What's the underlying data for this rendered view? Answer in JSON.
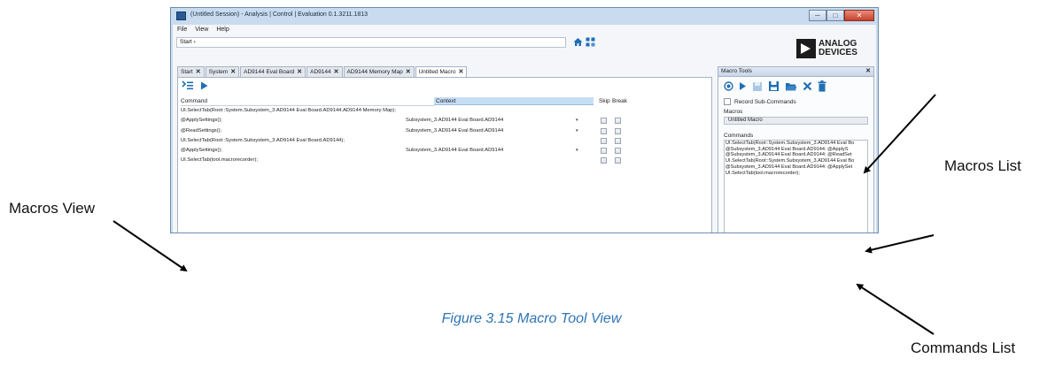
{
  "window": {
    "title": "(Untitled Session) - Analysis | Control | Evaluation 0.1.3211.1813",
    "caption_min": "─",
    "caption_max": "□",
    "caption_close": "✕"
  },
  "menu": [
    "File",
    "View",
    "Help"
  ],
  "breadcrumb": "Start  ›",
  "logo": {
    "line1": "ANALOG",
    "line2": "DEVICES"
  },
  "tabs": [
    {
      "label": "Start",
      "active": false
    },
    {
      "label": "System",
      "active": false
    },
    {
      "label": "AD9144 Eval Board",
      "active": false
    },
    {
      "label": "AD9144",
      "active": false
    },
    {
      "label": "AD9144 Memory Map",
      "active": false
    },
    {
      "label": "Untitled Macro",
      "active": true
    }
  ],
  "tab_close": "✕",
  "grid": {
    "columns": {
      "command": "Command",
      "context": "Context",
      "skip": "Skip",
      "break": "Break"
    },
    "rows": [
      {
        "command": "UI.SelectTab(Root::System.Subsystem_3.AD9144 Eval Board.AD9144.AD9144 Memory Map);",
        "context": "",
        "checks": false
      },
      {
        "command": "@ApplySettings();",
        "context": "Subsystem_3.AD9144 Eval Board.AD9144",
        "checks": true
      },
      {
        "command": "@ReadSettings();",
        "context": "Subsystem_3.AD9144 Eval Board.AD9144",
        "checks": true
      },
      {
        "command": "UI.SelectTab(Root::System.Subsystem_3.AD9144 Eval Board.AD9144);",
        "context": "",
        "checks": true
      },
      {
        "command": "@ApplySettings();",
        "context": "Subsystem_3.AD9144 Eval Board.AD9144",
        "checks": true
      },
      {
        "command": "UI.SelectTab(tool.macrorecorder);",
        "context": "",
        "checks": true
      }
    ],
    "dropdown_glyph": "▾"
  },
  "macro_tools": {
    "title": "Macro Tools",
    "close": "✕",
    "record_sub_commands": "Record Sub-Commands",
    "macros_label": "Macros",
    "macros": [
      "Untitled Macro"
    ],
    "commands_label": "Commands",
    "commands": [
      "UI.SelectTab(Root::System.Subsystem_3.AD9144 Eval Bo",
      "@Subsystem_3.AD9144 Eval Board.AD9144: @ApplyS",
      "@Subsystem_3.AD9144 Eval Board.AD9144: @ReadSet",
      "UI.SelectTab(Root::System.Subsystem_3.AD9144 Eval Bo",
      "@Subsystem_3.AD9144 Eval Board.AD9144: @ApplySet",
      "UI.SelectTab(tool.macrorecorder);"
    ]
  },
  "annotations": {
    "macros_view": "Macros View",
    "macros_list": "Macros List",
    "commands_list": "Commands List",
    "caption": "Figure 3.15 Macro Tool View"
  },
  "colors": {
    "window_frame": "#c9dcef",
    "context_header": "#c6def4",
    "icon_blue": "#1f6fb5",
    "caption_blue": "#2e75b6"
  }
}
